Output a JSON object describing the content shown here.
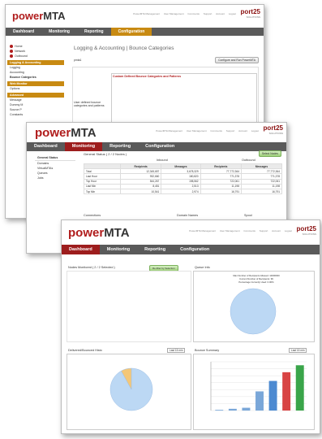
{
  "brand": {
    "logo_pre": "power",
    "logo_post": "MTA",
    "company": "port25",
    "company_tag": "SOLUTIONS"
  },
  "top_links": [
    "PowerMTA Management",
    "User Management",
    "Comments",
    "Support",
    "Account",
    "Logout"
  ],
  "win_a": {
    "nav": [
      "Dashboard",
      "Monitoring",
      "Reporting",
      "Configuration"
    ],
    "active_tab": 3,
    "title": "Logging & Accounting | Bounce Categories",
    "sidebar": [
      {
        "type": "item",
        "label": "Home"
      },
      {
        "type": "item",
        "label": "Network"
      },
      {
        "type": "item",
        "label": "Outbound"
      },
      {
        "type": "head",
        "label": "Logging & Accounting"
      },
      {
        "type": "item",
        "label": "Logging"
      },
      {
        "type": "item",
        "label": "Accounting"
      },
      {
        "type": "item",
        "label": "Bounce Categories"
      },
      {
        "type": "head",
        "label": "Web Monitor"
      },
      {
        "type": "item",
        "label": "Options"
      },
      {
        "type": "head",
        "label": "Advanced"
      },
      {
        "type": "item",
        "label": "Message"
      },
      {
        "type": "item",
        "label": "Dummy M"
      },
      {
        "type": "item",
        "label": "Source P"
      },
      {
        "type": "item",
        "label": "Constants"
      }
    ],
    "server_input": "pmta1",
    "apply_button": "Configure and Run PowerMTA",
    "box_label": "User defined bounce categories and patterns",
    "red_heading": "Custom Defined Bounce Categories and Patterns"
  },
  "win_b": {
    "nav": [
      "Dashboard",
      "Monitoring",
      "Reporting",
      "Configuration"
    ],
    "active_tab": 1,
    "sidebar": [
      "General Status",
      "Domains",
      "VirtualMTAs",
      "Queues",
      "Jobs"
    ],
    "section_title": "General Status ( 2 / 2 Nodes )",
    "select_button": "Select Nodes",
    "group_inbound": "Inbound",
    "group_outbound": "Outbound",
    "columns": [
      "",
      "Recipients",
      "Messages",
      "Recipients",
      "Messages"
    ],
    "rows": [
      [
        "Total",
        "12,345,657",
        "3,678,329",
        "77,772,364",
        "77,772,364"
      ],
      [
        "Last Hour",
        "932,660",
        "180,820",
        "771,378",
        "771,378"
      ],
      [
        "Top Hour",
        "544,267",
        "198,562",
        "722,061",
        "722,061"
      ],
      [
        "Last Min",
        "8,451",
        "2,513",
        "11,198",
        "11,198"
      ],
      [
        "Top Min",
        "10,541",
        "2,974",
        "16,791",
        "16,791"
      ]
    ],
    "footer": [
      "Connections",
      "Domain Names",
      "Spool"
    ],
    "footer_sub": [
      "In",
      "Max",
      "Cached",
      "0",
      "Files in Use"
    ]
  },
  "win_c": {
    "nav": [
      "Dashboard",
      "Monitoring",
      "Reporting",
      "Configuration"
    ],
    "active_tab": 0,
    "nodes_title": "Nodes Monitored ( 2 / 2 Selected )",
    "nodes_button": "Re-filter by Selection",
    "queue_title": "Queue Info",
    "node_columns": [
      "Machine",
      "Status",
      "Uptime",
      "Started On"
    ],
    "node_rows": [
      [
        "pmta1",
        "",
        "6:23:30:59",
        "2011-02-01 15:03:14"
      ],
      [
        "pmta2",
        "",
        "6:23:17:52",
        "2011-02-01 15:07:21"
      ]
    ],
    "queue_lines": [
      "Max Number of Recipients Allowed: 10000000",
      "Current Number of Recipients: 99",
      "Percentage Currently Used: 0.00%"
    ],
    "delivered_title": "Delivered/Bounced Histo",
    "bounce_title": "Bounce Summary",
    "range_select": "Last 15 min"
  },
  "chart_data": [
    {
      "type": "pie",
      "title": "Queue Info",
      "values": [
        100
      ],
      "colors": [
        "#bcd8f4"
      ]
    },
    {
      "type": "pie",
      "title": "Delivered/Bounced Histo",
      "values": [
        92,
        8
      ],
      "colors": [
        "#bcd8f4",
        "#f4c778"
      ]
    },
    {
      "type": "bar",
      "title": "Bounce Summary",
      "values": [
        2,
        5,
        8,
        55,
        85,
        110,
        130
      ],
      "colors": [
        "#7aa7d9",
        "#7aa7d9",
        "#7aa7d9",
        "#7aa7d9",
        "#4c8ad1",
        "#d84444",
        "#3aa54a"
      ],
      "ylim": [
        0,
        140
      ]
    }
  ]
}
